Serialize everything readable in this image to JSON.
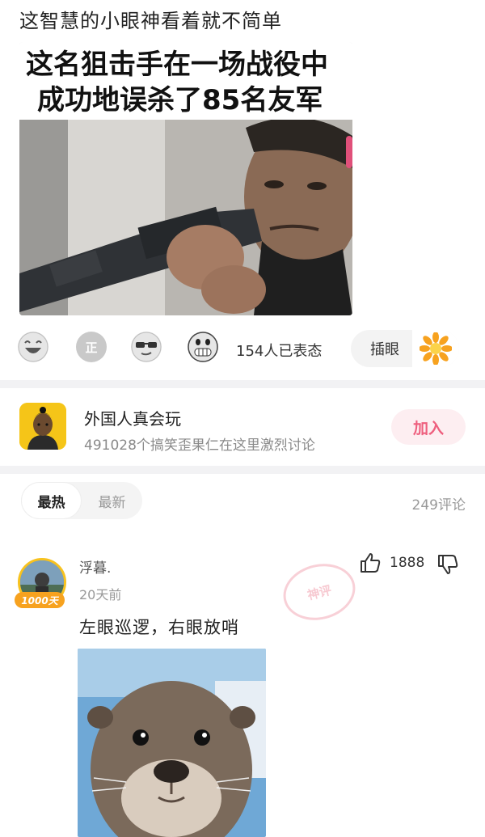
{
  "post": {
    "title": "这智慧的小眼神看着就不简单",
    "meme_caption_line1": "这名狙击手在一场战役中",
    "meme_caption_line2": "成功地误杀了85名友军"
  },
  "reactions": {
    "emoji_2_label": "正",
    "count_text": "154人已表态",
    "chaoyan_label": "插眼"
  },
  "group": {
    "name": "外国人真会玩",
    "description": "491028个搞笑歪果仁在这里激烈讨论",
    "join_label": "加入"
  },
  "comments_header": {
    "tab_hot": "最热",
    "tab_new": "最新",
    "count": "249评论"
  },
  "comment": {
    "badge": "1000天",
    "username": "浮暮.",
    "time": "20天前",
    "text": "左眼巡逻，右眼放哨",
    "like_count": "1888",
    "stamp": "神评"
  },
  "colors": {
    "accent_pink": "#ee5f7e",
    "separator": "#f2f2f4",
    "badge_gold": "#f7a21f"
  }
}
